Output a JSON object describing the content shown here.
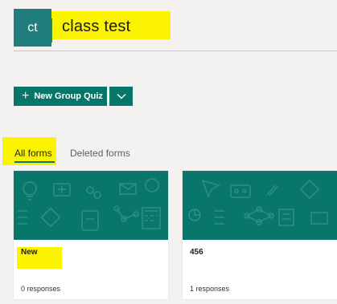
{
  "group": {
    "initials": "ct",
    "title": "class test"
  },
  "toolbar": {
    "new_quiz_label": "New Group Quiz"
  },
  "tabs": [
    {
      "label": "All forms",
      "selected": true
    },
    {
      "label": "Deleted forms",
      "selected": false
    }
  ],
  "forms": [
    {
      "name": "New",
      "responses": "0 responses"
    },
    {
      "name": "456",
      "responses": "1 responses"
    }
  ],
  "colors": {
    "accent": "#077568",
    "avatar": "#1f7d7d",
    "highlight": "#fbf300"
  }
}
